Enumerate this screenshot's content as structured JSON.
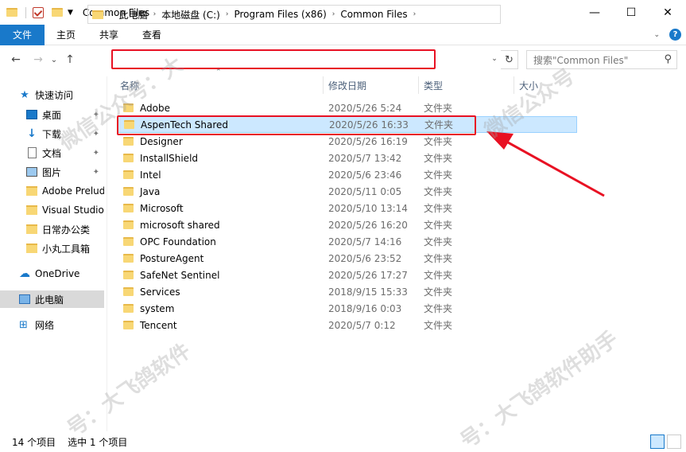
{
  "window": {
    "title": "Common Files",
    "minimize_glyph": "—",
    "maximize_glyph": "☐",
    "close_glyph": "✕"
  },
  "ribbon": {
    "tabs": [
      "文件",
      "主页",
      "共享",
      "查看"
    ]
  },
  "nav": {
    "back_glyph": "←",
    "forward_glyph": "→",
    "recent_glyph": "⌄",
    "up_glyph": "↑",
    "breadcrumbs": [
      "此电脑",
      "本地磁盘 (C:)",
      "Program Files (x86)",
      "Common Files"
    ],
    "crumb_separator": "›",
    "dropdown_glyph": "⌄",
    "refresh_glyph": "↻",
    "search_placeholder": "搜索\"Common Files\"",
    "search_glyph": "⚲"
  },
  "sidebar": {
    "items": [
      {
        "label": "快速访问",
        "icon": "star-icon",
        "pinned": false
      },
      {
        "label": "桌面",
        "icon": "desktop-icon",
        "pinned": true
      },
      {
        "label": "下载",
        "icon": "download-icon",
        "pinned": true
      },
      {
        "label": "文档",
        "icon": "document-icon",
        "pinned": true
      },
      {
        "label": "图片",
        "icon": "pictures-icon",
        "pinned": true
      },
      {
        "label": "Adobe Prelude",
        "icon": "folder-icon",
        "pinned": false
      },
      {
        "label": "Visual Studio",
        "icon": "folder-icon",
        "pinned": false
      },
      {
        "label": "日常办公类",
        "icon": "folder-icon",
        "pinned": false
      },
      {
        "label": "小丸工具箱",
        "icon": "folder-icon",
        "pinned": false
      },
      {
        "label": "OneDrive",
        "icon": "cloud-icon",
        "pinned": false
      },
      {
        "label": "此电脑",
        "icon": "computer-icon",
        "pinned": false,
        "selected": true
      },
      {
        "label": "网络",
        "icon": "network-icon",
        "pinned": false
      }
    ]
  },
  "columns": {
    "name": "名称",
    "date": "修改日期",
    "type": "类型",
    "size": "大小"
  },
  "files": [
    {
      "name": "Adobe",
      "date": "2020/5/26 5:24",
      "type": "文件夹"
    },
    {
      "name": "AspenTech Shared",
      "date": "2020/5/26 16:33",
      "type": "文件夹",
      "selected": true
    },
    {
      "name": "Designer",
      "date": "2020/5/26 16:19",
      "type": "文件夹"
    },
    {
      "name": "InstallShield",
      "date": "2020/5/7 13:42",
      "type": "文件夹"
    },
    {
      "name": "Intel",
      "date": "2020/5/6 23:46",
      "type": "文件夹"
    },
    {
      "name": "Java",
      "date": "2020/5/11 0:05",
      "type": "文件夹"
    },
    {
      "name": "Microsoft",
      "date": "2020/5/10 13:14",
      "type": "文件夹"
    },
    {
      "name": "microsoft shared",
      "date": "2020/5/26 16:20",
      "type": "文件夹"
    },
    {
      "name": "OPC Foundation",
      "date": "2020/5/7 14:16",
      "type": "文件夹"
    },
    {
      "name": "PostureAgent",
      "date": "2020/5/6 23:52",
      "type": "文件夹"
    },
    {
      "name": "SafeNet Sentinel",
      "date": "2020/5/26 17:27",
      "type": "文件夹"
    },
    {
      "name": "Services",
      "date": "2018/9/15 15:33",
      "type": "文件夹"
    },
    {
      "name": "system",
      "date": "2018/9/16 0:03",
      "type": "文件夹"
    },
    {
      "name": "Tencent",
      "date": "2020/5/7 0:12",
      "type": "文件夹"
    }
  ],
  "status": {
    "item_count": "14 个项目",
    "selected_count": "选中 1 个项目"
  },
  "colors": {
    "accent": "#1979ca",
    "selection": "#cce8ff",
    "annotation_red": "#e81123"
  }
}
